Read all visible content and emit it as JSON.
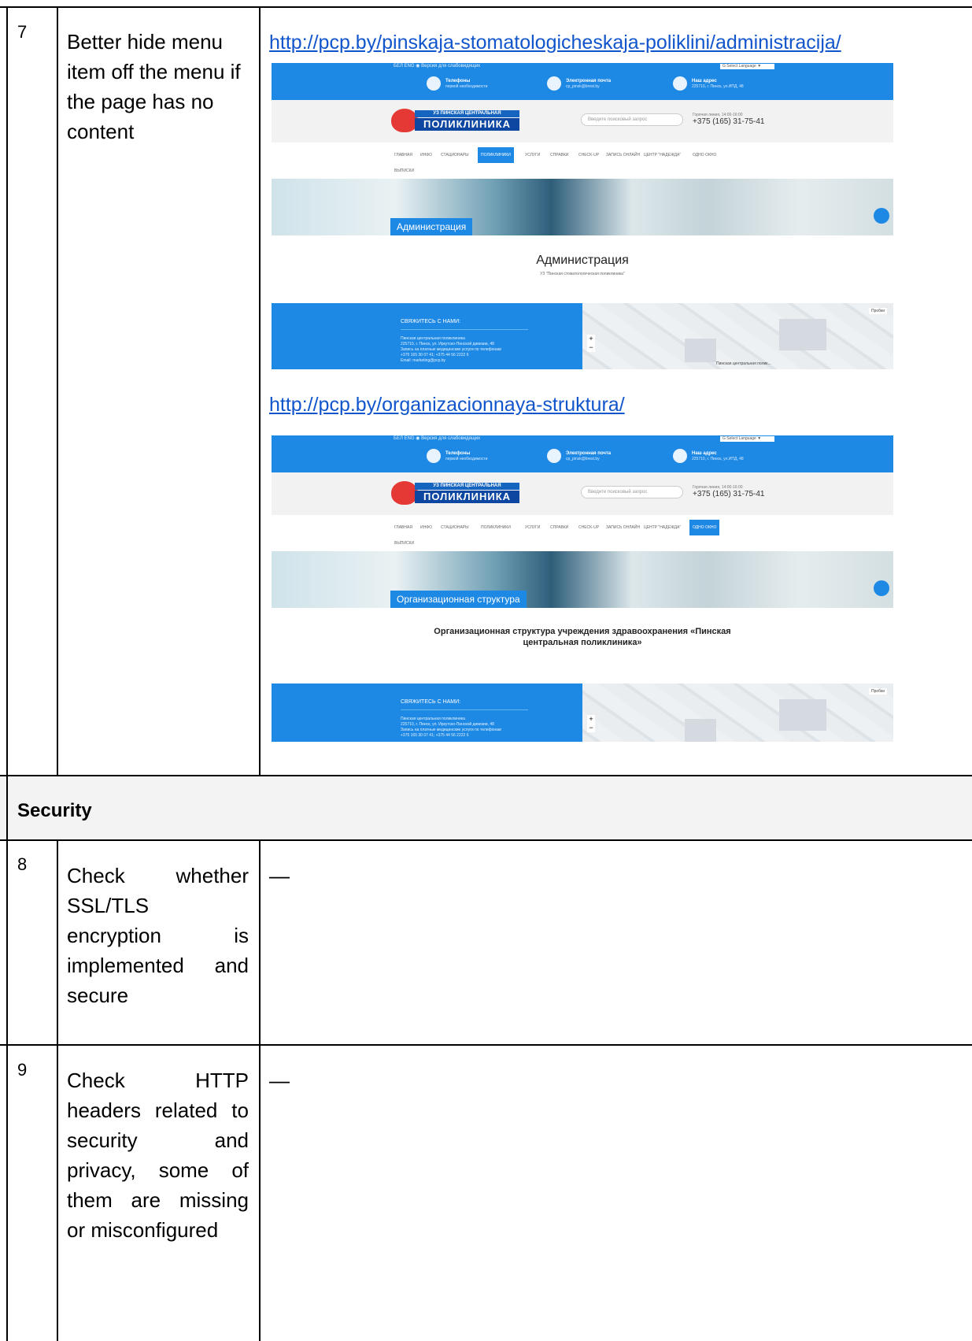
{
  "rows": [
    {
      "number": "7",
      "issue": "Better hide menu item off the menu if the page has no content",
      "evidence": [
        {
          "url": "http://pcp.by/pinskaja-stomatologicheskaja-poliklini/administracija/",
          "screenshot": {
            "lang_bar": "БЕЛ ENG  ◉ Версия для слабовидящих",
            "translate": "G Select Language ▼",
            "phones_title": "Телефоны",
            "phones_sub": "первой необходимости",
            "email_title": "Электронная почта",
            "email_sub": "cp_pinsk@brest.by",
            "address_title": "Наш адрес",
            "address_sub": "225710, г. Пинск, ул.ИПД, 48",
            "logo_line1": "УЗ ПИНСКАЯ ЦЕНТРАЛЬНАЯ",
            "logo_line2": "ПОЛИКЛИНИКА",
            "search_placeholder": "Введите поисковый запрос",
            "hotline_label": "Горячая линия, 14:00-16:00",
            "hotline_phone": "+375 (165) 31-75-41",
            "nav": [
              "ГЛАВНАЯ",
              "ИНФО",
              "СТАЦИОНАРЫ",
              "ПОЛИКЛИНИКИ",
              "УСЛУГИ",
              "СПРАВКИ",
              "CHECK-UP",
              "ЗАПИСЬ ОНЛАЙН",
              "ЦЕНТР \"НАДЕЖДА\"",
              "ОДНО ОКНО"
            ],
            "nav_second": "ВЫПИСКИ",
            "banner_label": "Администрация",
            "page_title": "Администрация",
            "page_subtitle": "УЗ \"Пинская стоматологическая поликлиника\"",
            "footer_heading": "СВЯЖИТЕСЬ С НАМИ:",
            "footer_lines": [
              "Пинская центральная поликлиника",
              "225710, г. Пинск, ул. Иркутско-Пинской дивизии, 48",
              "Запись на платные медицинские услуги по телефонам:",
              "+375 165 30 07 41; +375 44 56 2222 6",
              "Email: marketing@pcp.by"
            ],
            "map_traffic": "Пробки",
            "map_place": "Пинская центральная полик..."
          }
        },
        {
          "url": "http://pcp.by/organizacionnaya-struktura/",
          "screenshot": {
            "lang_bar": "БЕЛ ENG  ◉ Версия для слабовидящих",
            "translate": "G Select Language ▼",
            "phones_title": "Телефоны",
            "phones_sub": "первой необходимости",
            "email_title": "Электронная почта",
            "email_sub": "cp_pinsk@brest.by",
            "address_title": "Наш адрес",
            "address_sub": "225710, г. Пинск, ул.ИПД, 48",
            "logo_line1": "УЗ ПИНСКАЯ ЦЕНТРАЛЬНАЯ",
            "logo_line2": "ПОЛИКЛИНИКА",
            "search_placeholder": "Введите поисковый запрос",
            "hotline_label": "Горячая линия, 14:00-16:00",
            "hotline_phone": "+375 (165) 31-75-41",
            "nav": [
              "ГЛАВНАЯ",
              "ИНФО",
              "СТАЦИОНАРЫ",
              "ПОЛИКЛИНИКИ",
              "УСЛУГИ",
              "СПРАВКИ",
              "CHECK-UP",
              "ЗАПИСЬ ОНЛАЙН",
              "ЦЕНТР \"НАДЕЖДА\"",
              "ОДНО ОКНО"
            ],
            "nav_second": "ВЫПИСКИ",
            "banner_label": "Организационная структура",
            "page_title_line1": "Организационная структура учреждения здравоохранения «Пинская",
            "page_title_line2": "центральная поликлиника»",
            "footer_heading": "СВЯЖИТЕСЬ С НАМИ:",
            "footer_lines": [
              "Пинская центральная поликлиника",
              "225710, г. Пинск, ул. Иркутско-Пинской дивизии, 48",
              "Запись на платные медицинские услуги по телефонам:",
              "+375 165 30 07 41; +375 44 56 2222 6"
            ],
            "map_traffic": "Пробки"
          }
        }
      ]
    },
    {
      "section": "Security"
    },
    {
      "number": "8",
      "issue_lines": [
        "Check whether",
        "SSL/TLS",
        "encryption is",
        "implemented and",
        "secure"
      ],
      "evidence": "—"
    },
    {
      "number": "9",
      "issue_lines": [
        "Check HTTP",
        "headers related to",
        "security and",
        "privacy, some of",
        "them are missing",
        "or misconfigured"
      ],
      "evidence": "—"
    }
  ]
}
